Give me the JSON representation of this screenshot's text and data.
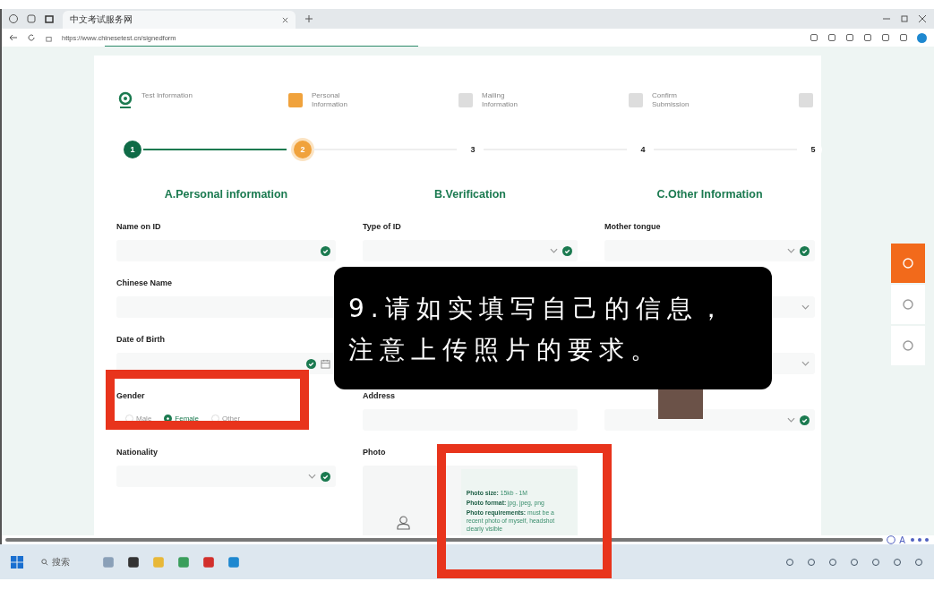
{
  "browser": {
    "tab_title": "中文考试服务网",
    "url": "https://www.chinesetest.cn/signedform"
  },
  "steps": [
    {
      "label": "Test Information",
      "number": "1",
      "completed": true,
      "selected": false
    },
    {
      "label": "Personal Information",
      "number": "2",
      "completed": false,
      "selected": true
    },
    {
      "label": "Mailing Information",
      "number": "3",
      "completed": false,
      "selected": false
    },
    {
      "label": "Confirm Submission",
      "number": "4",
      "completed": false,
      "selected": false
    },
    {
      "number": "5",
      "completed": false,
      "selected": false
    }
  ],
  "sections": [
    {
      "title": "A.Personal information",
      "fields": [
        {
          "kind": "text",
          "label": "Name on ID",
          "valid": true
        },
        {
          "kind": "text",
          "label": "Chinese Name",
          "valid": false
        },
        {
          "kind": "date",
          "label": "Date of Birth",
          "valid": true
        },
        {
          "kind": "radio",
          "label": "Gender",
          "highlighted": true,
          "options": [
            {
              "label": "Male",
              "selected": false
            },
            {
              "label": "Female",
              "selected": true
            },
            {
              "label": "Other",
              "selected": false
            }
          ]
        },
        {
          "kind": "select",
          "label": "Nationality",
          "valid": true
        }
      ]
    },
    {
      "title": "B.Verification",
      "fields": [
        {
          "kind": "select",
          "label": "Type of ID",
          "valid": true
        },
        {
          "kind": "covered"
        },
        {
          "kind": "covered"
        },
        {
          "kind": "text",
          "label": "Address",
          "valid": false
        },
        {
          "kind": "photo",
          "label": "Photo",
          "highlighted": true,
          "requirements": [
            "**Photo size:** 15kb - 1M",
            "**Photo format:** jpg, jpeg, png",
            "**Photo requirements:** must be a recent photo of myself, headshot clearly visible"
          ]
        }
      ]
    },
    {
      "title": "C.Other Information",
      "fields": [
        {
          "kind": "select",
          "label": "Mother tongue",
          "valid": true
        },
        {
          "kind": "select",
          "valid": false
        },
        {
          "kind": "select",
          "valid": false
        },
        {
          "kind": "select",
          "valid": true
        }
      ]
    }
  ],
  "caption": {
    "lines": [
      "9.请如实填写自己的信息，",
      "注意上传照片的要求。"
    ]
  },
  "side_buttons": [
    {
      "selected": true
    },
    {
      "selected": false
    },
    {
      "selected": false
    }
  ],
  "page_toolbar": {
    "letter": "A"
  },
  "taskbar": {
    "search": "搜索"
  }
}
